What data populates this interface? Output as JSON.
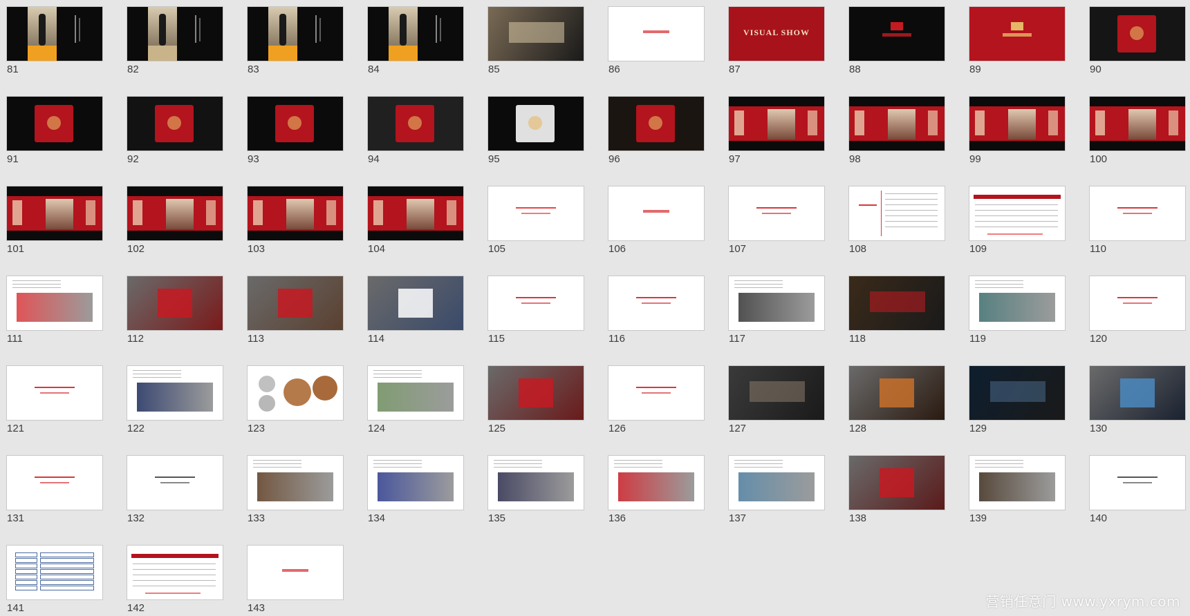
{
  "watermark": "营销任意门 www.yxrym.com",
  "slides": [
    {
      "num": "81",
      "kind": "portrait",
      "bg": "#0b0b0b",
      "accent": "#f0a020"
    },
    {
      "num": "82",
      "kind": "portrait",
      "bg": "#0b0b0b",
      "accent": "#c9b48a"
    },
    {
      "num": "83",
      "kind": "portrait",
      "bg": "#0b0b0b",
      "accent": "#f0a020"
    },
    {
      "num": "84",
      "kind": "portrait",
      "bg": "#0b0b0b",
      "accent": "#f0a020"
    },
    {
      "num": "85",
      "kind": "photo",
      "bg": "#7a6a55",
      "accent": "#d8c8a5"
    },
    {
      "num": "86",
      "kind": "white-label",
      "bg": "#ffffff",
      "accent": "#d9373a"
    },
    {
      "num": "87",
      "kind": "visual",
      "bg": "#a8121b",
      "accent": "#f3e2c2",
      "text": "VISUAL SHOW"
    },
    {
      "num": "88",
      "kind": "brand",
      "bg": "#0b0b0b",
      "accent": "#c51a22"
    },
    {
      "num": "89",
      "kind": "brand",
      "bg": "#b3141d",
      "accent": "#e6b765"
    },
    {
      "num": "90",
      "kind": "product",
      "bg": "#151515",
      "accent": "#b3141d"
    },
    {
      "num": "91",
      "kind": "product",
      "bg": "#0b0b0b",
      "accent": "#b3141d"
    },
    {
      "num": "92",
      "kind": "product",
      "bg": "#121212",
      "accent": "#b3141d"
    },
    {
      "num": "93",
      "kind": "product",
      "bg": "#0b0b0b",
      "accent": "#b3141d"
    },
    {
      "num": "94",
      "kind": "product",
      "bg": "#202020",
      "accent": "#b3141d"
    },
    {
      "num": "95",
      "kind": "product",
      "bg": "#0b0b0b",
      "accent": "#e0e0e0"
    },
    {
      "num": "96",
      "kind": "product",
      "bg": "#1a1510",
      "accent": "#b3141d"
    },
    {
      "num": "97",
      "kind": "banner",
      "bg": "#0b0b0b",
      "accent": "#b3141d"
    },
    {
      "num": "98",
      "kind": "banner",
      "bg": "#0b0b0b",
      "accent": "#b3141d"
    },
    {
      "num": "99",
      "kind": "banner",
      "bg": "#0b0b0b",
      "accent": "#b3141d"
    },
    {
      "num": "100",
      "kind": "banner",
      "bg": "#0b0b0b",
      "accent": "#b3141d"
    },
    {
      "num": "101",
      "kind": "banner",
      "bg": "#0b0b0b",
      "accent": "#b3141d"
    },
    {
      "num": "102",
      "kind": "banner",
      "bg": "#0b0b0b",
      "accent": "#b3141d"
    },
    {
      "num": "103",
      "kind": "banner",
      "bg": "#0b0b0b",
      "accent": "#b3141d"
    },
    {
      "num": "104",
      "kind": "banner",
      "bg": "#0b0b0b",
      "accent": "#b3141d"
    },
    {
      "num": "105",
      "kind": "white-text",
      "bg": "#ffffff",
      "accent": "#e64545"
    },
    {
      "num": "106",
      "kind": "white-label",
      "bg": "#ffffff",
      "accent": "#d9373a"
    },
    {
      "num": "107",
      "kind": "white-text",
      "bg": "#ffffff",
      "accent": "#d9373a"
    },
    {
      "num": "108",
      "kind": "white-doc",
      "bg": "#ffffff",
      "accent": "#d9373a"
    },
    {
      "num": "109",
      "kind": "timeline",
      "bg": "#ffffff",
      "accent": "#b3141d"
    },
    {
      "num": "110",
      "kind": "white-text",
      "bg": "#ffffff",
      "accent": "#d9373a"
    },
    {
      "num": "111",
      "kind": "doc-photo",
      "bg": "#ffffff",
      "accent": "#d9373a"
    },
    {
      "num": "112",
      "kind": "collage",
      "bg": "#7a1a1a",
      "accent": "#c51a22"
    },
    {
      "num": "113",
      "kind": "collage",
      "bg": "#5a4030",
      "accent": "#c51a22"
    },
    {
      "num": "114",
      "kind": "collage",
      "bg": "#3a4a6a",
      "accent": "#ffffff"
    },
    {
      "num": "115",
      "kind": "white-text",
      "bg": "#ffffff",
      "accent": "#d9373a"
    },
    {
      "num": "116",
      "kind": "white-text",
      "bg": "#ffffff",
      "accent": "#d9373a"
    },
    {
      "num": "117",
      "kind": "doc-photo",
      "bg": "#ffffff",
      "accent": "#333333"
    },
    {
      "num": "118",
      "kind": "photo",
      "bg": "#3a2a1a",
      "accent": "#c51a22"
    },
    {
      "num": "119",
      "kind": "doc-photo",
      "bg": "#ffffff",
      "accent": "#3a6a6a"
    },
    {
      "num": "120",
      "kind": "white-text",
      "bg": "#ffffff",
      "accent": "#d9373a"
    },
    {
      "num": "121",
      "kind": "white-text",
      "bg": "#ffffff",
      "accent": "#d9373a"
    },
    {
      "num": "122",
      "kind": "doc-photo",
      "bg": "#ffffff",
      "accent": "#1a2a5a"
    },
    {
      "num": "123",
      "kind": "coins",
      "bg": "#ffffff",
      "accent": "#b57a4a"
    },
    {
      "num": "124",
      "kind": "doc-photo",
      "bg": "#ffffff",
      "accent": "#6a8a5a"
    },
    {
      "num": "125",
      "kind": "collage",
      "bg": "#6a1a1a",
      "accent": "#c51a22"
    },
    {
      "num": "126",
      "kind": "white-text",
      "bg": "#ffffff",
      "accent": "#d9373a"
    },
    {
      "num": "127",
      "kind": "photo",
      "bg": "#3a3a3a",
      "accent": "#8a7a6a"
    },
    {
      "num": "128",
      "kind": "collage",
      "bg": "#2a1a10",
      "accent": "#c8702a"
    },
    {
      "num": "129",
      "kind": "photo",
      "bg": "#0e1e2e",
      "accent": "#4a6a8a"
    },
    {
      "num": "130",
      "kind": "collage",
      "bg": "#1a2230",
      "accent": "#4a8ac0"
    },
    {
      "num": "131",
      "kind": "white-text",
      "bg": "#ffffff",
      "accent": "#d9373a"
    },
    {
      "num": "132",
      "kind": "white-text",
      "bg": "#ffffff",
      "accent": "#555555"
    },
    {
      "num": "133",
      "kind": "doc-photo",
      "bg": "#ffffff",
      "accent": "#5a3a20"
    },
    {
      "num": "134",
      "kind": "doc-photo",
      "bg": "#ffffff",
      "accent": "#2a3a8a"
    },
    {
      "num": "135",
      "kind": "doc-photo",
      "bg": "#ffffff",
      "accent": "#2a2a4a"
    },
    {
      "num": "136",
      "kind": "doc-photo",
      "bg": "#ffffff",
      "accent": "#c51a22"
    },
    {
      "num": "137",
      "kind": "doc-photo",
      "bg": "#ffffff",
      "accent": "#4a7a9a"
    },
    {
      "num": "138",
      "kind": "collage",
      "bg": "#5a1a1a",
      "accent": "#c51a22"
    },
    {
      "num": "139",
      "kind": "doc-photo",
      "bg": "#ffffff",
      "accent": "#3a2a1a"
    },
    {
      "num": "140",
      "kind": "white-text",
      "bg": "#ffffff",
      "accent": "#555555"
    },
    {
      "num": "141",
      "kind": "table",
      "bg": "#ffffff",
      "accent": "#4a6aa0"
    },
    {
      "num": "142",
      "kind": "timeline",
      "bg": "#ffffff",
      "accent": "#b3141d"
    },
    {
      "num": "143",
      "kind": "white-label",
      "bg": "#ffffff",
      "accent": "#d9373a"
    }
  ]
}
